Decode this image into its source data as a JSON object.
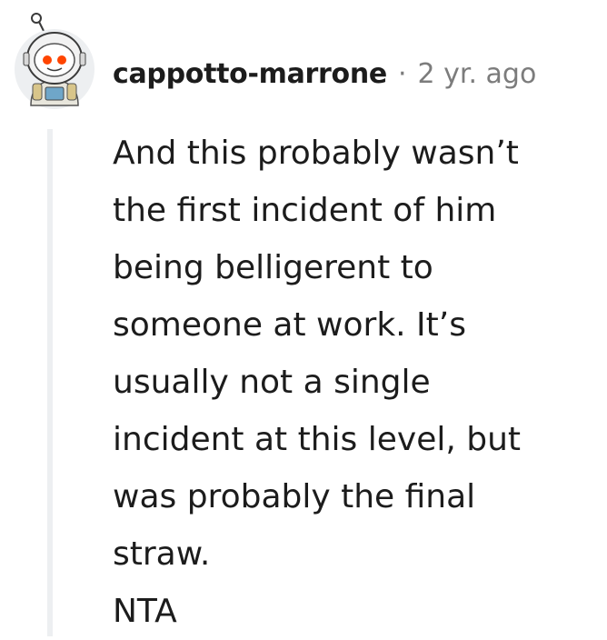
{
  "comment": {
    "author": "cappotto-marrone",
    "separator": "·",
    "timestamp": "2 yr. ago",
    "avatar_icon": "snoo-astronaut-avatar-icon",
    "body_lines": [
      "And this probably wasn’t",
      "the first incident of him",
      "being belligerent to",
      "someone at work. It’s",
      "usually not a single",
      "incident at this level, but",
      "was probably the final",
      "straw.",
      "NTA"
    ]
  },
  "colors": {
    "text": "#1c1c1c",
    "meta": "#7c7c7c",
    "thread_line": "#edeff1",
    "avatar_accent": "#ff4500"
  }
}
